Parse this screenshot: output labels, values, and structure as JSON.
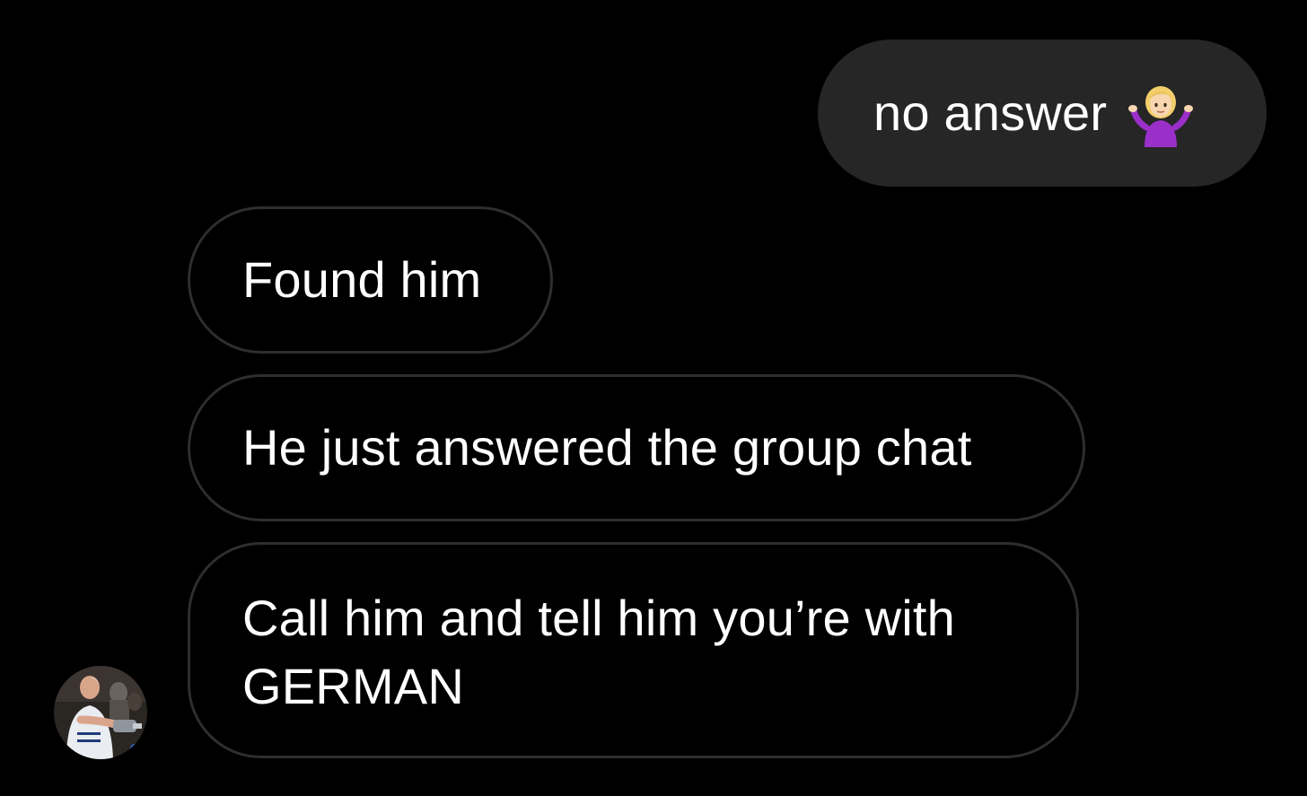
{
  "conversation": {
    "messages": [
      {
        "sender": "me",
        "text": "no answer",
        "emoji": "woman-shrugging-emoji"
      },
      {
        "sender": "contact",
        "text": "Found him"
      },
      {
        "sender": "contact",
        "text": "He just answered the group chat"
      },
      {
        "sender": "contact",
        "text": "Call him and tell him you’re with GERMAN"
      }
    ],
    "contact": {
      "avatar": "contact-avatar-photo"
    }
  },
  "colors": {
    "background": "#000000",
    "outgoing_bubble": "#262626",
    "incoming_border": "#2e2e2e",
    "text": "#ffffff"
  }
}
